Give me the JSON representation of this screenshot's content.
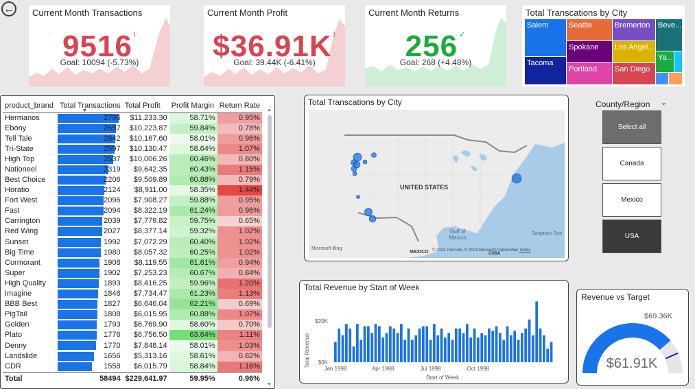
{
  "nav": {
    "back_icon": "arrow-left-circle-icon"
  },
  "kpis": [
    {
      "title": "Current Month Transactions",
      "value": "9516",
      "mark": "!",
      "goal": "Goal: 10094 (-5.73%)",
      "color": "#d64550",
      "fill": "#f5d0d3"
    },
    {
      "title": "Current Month Profit",
      "value": "$36.91K",
      "mark": "!",
      "goal": "Goal: 39.44K (-6.41%)",
      "color": "#d64550",
      "fill": "#f5d0d3"
    },
    {
      "title": "Current Month Returns",
      "value": "256",
      "mark": "✓",
      "goal": "Goal: 268 (+4.48%)",
      "color": "#1aab40",
      "fill": "#cfeed8"
    }
  ],
  "treemap": {
    "title": "Total Transcations by City",
    "cells": [
      {
        "label": "Salem",
        "color": "#1a73e8"
      },
      {
        "label": "Tacoma",
        "color": "#12239e"
      },
      {
        "label": "Seattle",
        "color": "#e66c37"
      },
      {
        "label": "Spokane",
        "color": "#6b007b"
      },
      {
        "label": "Portland",
        "color": "#e044a7"
      },
      {
        "label": "Bremerton",
        "color": "#744ec2"
      },
      {
        "label": "Los Angel...",
        "color": "#d9b300"
      },
      {
        "label": "San Diego",
        "color": "#d64550"
      },
      {
        "label": "Beve...",
        "color": "#197278"
      },
      {
        "label": "Ya...",
        "color": "#1aab40"
      },
      {
        "label": "",
        "color": "#15c6f4"
      },
      {
        "label": "",
        "color": "#4092ff"
      },
      {
        "label": "",
        "color": "#ffa058"
      }
    ]
  },
  "table": {
    "headers": [
      "product_brand",
      "Total Transactions",
      "Total Profit",
      "Profit Margin",
      "Return Rate"
    ],
    "max_tx": 2796,
    "rows": [
      [
        "Hermanos",
        "2796",
        "$11,233.30",
        "58.71%",
        "0.95%"
      ],
      [
        "Ebony",
        "2657",
        "$10,223.87",
        "59.84%",
        "0.78%"
      ],
      [
        "Tell Tale",
        "2642",
        "$10,167.60",
        "58.01%",
        "0.96%"
      ],
      [
        "Tri-State",
        "2597",
        "$10,130.47",
        "58.64%",
        "1.07%"
      ],
      [
        "High Top",
        "2537",
        "$10,006.26",
        "60.46%",
        "0.80%"
      ],
      [
        "Nationeel",
        "2319",
        "$9,642.35",
        "60.43%",
        "1.15%"
      ],
      [
        "Best Choice",
        "2206",
        "$9,509.89",
        "60.88%",
        "0.79%"
      ],
      [
        "Horatio",
        "2124",
        "$8,911.00",
        "58.35%",
        "1.44%"
      ],
      [
        "Fort West",
        "2096",
        "$7,908.27",
        "59.88%",
        "0.95%"
      ],
      [
        "Fast",
        "2094",
        "$8,322.19",
        "61.24%",
        "0.96%"
      ],
      [
        "Carrington",
        "2039",
        "$7,779.82",
        "59.75%",
        "0.65%"
      ],
      [
        "Red Wing",
        "2027",
        "$8,377.14",
        "59.32%",
        "1.02%"
      ],
      [
        "Sunset",
        "1992",
        "$7,072.29",
        "60.40%",
        "1.02%"
      ],
      [
        "Big Time",
        "1980",
        "$8,057.32",
        "60.25%",
        "1.02%"
      ],
      [
        "Cormorant",
        "1908",
        "$8,119.55",
        "61.61%",
        "0.94%"
      ],
      [
        "Super",
        "1902",
        "$7,253.23",
        "60.67%",
        "0.84%"
      ],
      [
        "High Quality",
        "1893",
        "$8,416.25",
        "59.96%",
        "1.20%"
      ],
      [
        "Imagine",
        "1848",
        "$7,734.47",
        "61.23%",
        "1.13%"
      ],
      [
        "BBB Best",
        "1827",
        "$6,646.04",
        "62.21%",
        "0.69%"
      ],
      [
        "PigTail",
        "1808",
        "$6,015.95",
        "60.88%",
        "1.07%"
      ],
      [
        "Golden",
        "1793",
        "$6,769.90",
        "58.60%",
        "0.70%"
      ],
      [
        "Plato",
        "1776",
        "$6,756.50",
        "63.64%",
        "1.11%"
      ],
      [
        "Denny",
        "1770",
        "$7,848.14",
        "58.01%",
        "1.03%"
      ],
      [
        "Landslide",
        "1656",
        "$5,313.16",
        "58.61%",
        "0.82%"
      ],
      [
        "CDR",
        "1558",
        "$6,015.79",
        "58.84%",
        "1.16%"
      ]
    ],
    "total": [
      "Total",
      "58494",
      "$229,641.97",
      "59.95%",
      "0.96%"
    ]
  },
  "map": {
    "title": "Total Transcations by City",
    "country_label": "UNITED STATES",
    "mexico_label": "MEXICO",
    "gulf_label": "Gulf of Mexico",
    "sea_label": "Sargasso Sea",
    "cuba_label": "CUBA",
    "bing_label": "Microsoft Bing",
    "copyright": "© 2022 TomTom, © 2023 Microsoft Corporation",
    "terms": "Terms",
    "bubble_color": "#1a73e8"
  },
  "slicer": {
    "title": "County/Region",
    "options": [
      {
        "label": "Select all",
        "selected": true,
        "bg": "#6d6d6d",
        "fg": "#ffffff"
      },
      {
        "label": "Canada",
        "selected": false,
        "bg": "#ffffff",
        "fg": "#252423"
      },
      {
        "label": "Mexico",
        "selected": false,
        "bg": "#ffffff",
        "fg": "#252423"
      },
      {
        "label": "USA",
        "selected": true,
        "bg": "#3a3a3a",
        "fg": "#ffffff"
      }
    ]
  },
  "gauge": {
    "title": "Revenue vs Target",
    "value_label": "$61.91K",
    "target_label": "$69.36K",
    "value": 61.91,
    "target": 69.36,
    "max": 80,
    "color": "#1a73e8"
  },
  "chart_data": {
    "type": "bar",
    "title": "Total Revenue by Start of Week",
    "xlabel": "Start of Week",
    "ylabel": "Total Revenue",
    "x_ticks": [
      "Jan 1998",
      "Apr 1998",
      "Jul 1998",
      "Oct 1998"
    ],
    "y_ticks": [
      "$0K",
      "$20K"
    ],
    "ylim": [
      0,
      32
    ],
    "color": "#1a73e8",
    "values": [
      9,
      15,
      12,
      17,
      15,
      7,
      17,
      10,
      16,
      16,
      13,
      17,
      16,
      11,
      13,
      16,
      15,
      13,
      17,
      10,
      15,
      10,
      12,
      15,
      16,
      16,
      10,
      17,
      12,
      15,
      11,
      13,
      10,
      15,
      15,
      13,
      17,
      11,
      15,
      11,
      13,
      12,
      15,
      14,
      16,
      13,
      10,
      16,
      12,
      14,
      10,
      13,
      15,
      19,
      12,
      27,
      15,
      12,
      6,
      9
    ]
  }
}
